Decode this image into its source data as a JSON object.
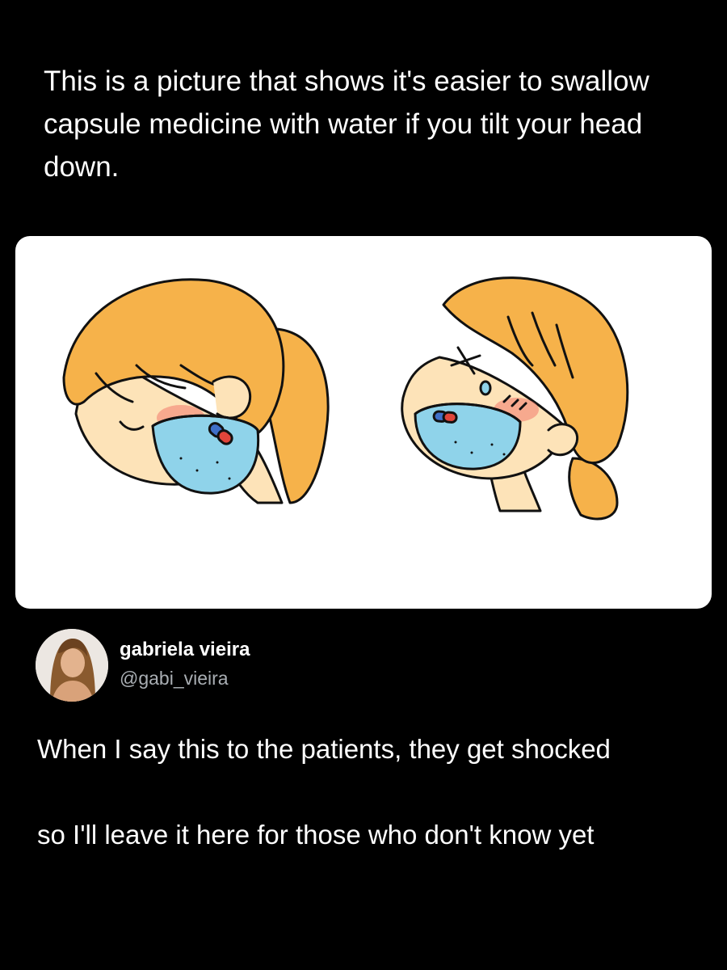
{
  "caption": "This is a picture that shows it's easier to swallow capsule medicine with water if you tilt your head down.",
  "illustration": {
    "left_panel": "girl tilting head down drinking water with capsule floating",
    "right_panel": "girl tilting head back, capsule stuck, tearing up",
    "colors": {
      "hair": "#f6b24a",
      "skin": "#fde3b8",
      "water": "#8fd3ea",
      "pill_red": "#e0453a",
      "pill_blue": "#3f6fc8",
      "blush": "#f27a6b"
    }
  },
  "author": {
    "name": "gabriela vieira",
    "handle": "@gabi_vieira"
  },
  "tweet": {
    "paragraph1": "When I say this to the patients, they get shocked",
    "paragraph2": "so I'll leave it here for those who don't know yet"
  },
  "theme": {
    "background": "#000000",
    "text": "#ffffff",
    "handle_color": "#a9aeb3"
  }
}
